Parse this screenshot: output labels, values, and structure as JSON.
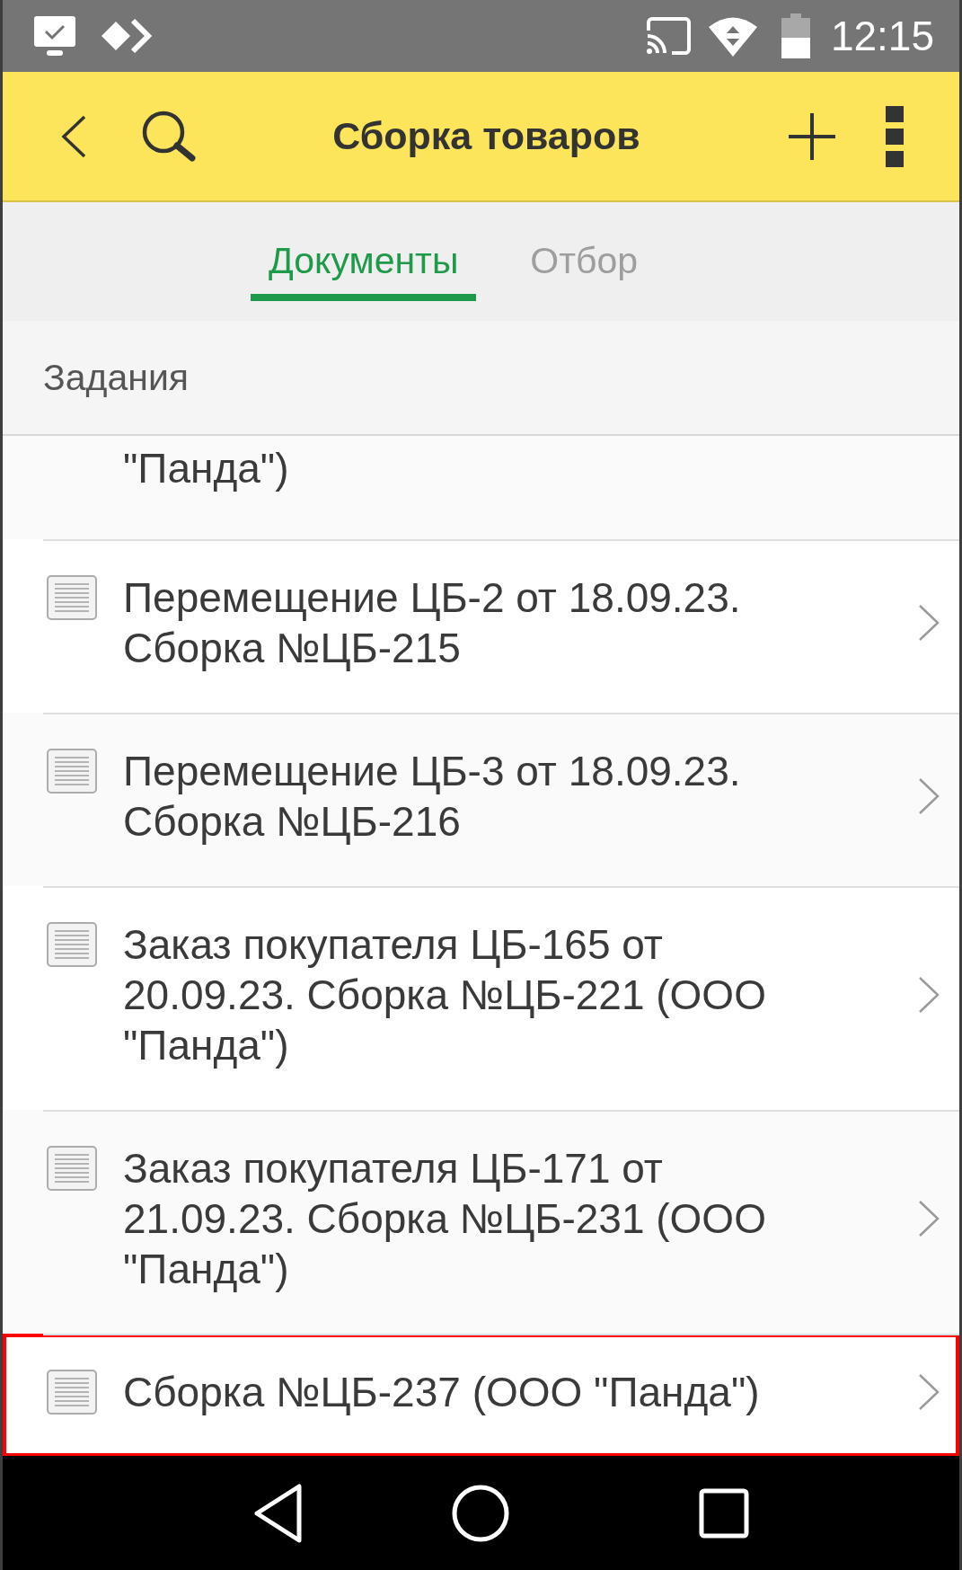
{
  "status_bar": {
    "time": "12:15"
  },
  "toolbar": {
    "title": "Сборка товаров"
  },
  "tabs": [
    {
      "label": "Документы",
      "selected": true
    },
    {
      "label": "Отбор",
      "selected": false
    }
  ],
  "section": {
    "title": "Задания"
  },
  "list": {
    "items": [
      {
        "kind": "partial",
        "text": "\"Панда\")",
        "highlighted": false
      },
      {
        "kind": "document",
        "text": "Перемещение ЦБ-2 от 18.09.23. Сборка №ЦБ-215",
        "highlighted": false
      },
      {
        "kind": "document",
        "text": "Перемещение ЦБ-3 от 18.09.23. Сборка №ЦБ-216",
        "highlighted": false
      },
      {
        "kind": "document",
        "text": "Заказ покупателя ЦБ-165 от 20.09.23. Сборка №ЦБ-221 (ООО \"Панда\")",
        "highlighted": false
      },
      {
        "kind": "document",
        "text": "Заказ покупателя ЦБ-171 от 21.09.23. Сборка №ЦБ-231 (ООО \"Панда\")",
        "highlighted": false
      },
      {
        "kind": "document",
        "text": "Сборка №ЦБ-237 (ООО \"Панда\")",
        "highlighted": true
      }
    ]
  }
}
